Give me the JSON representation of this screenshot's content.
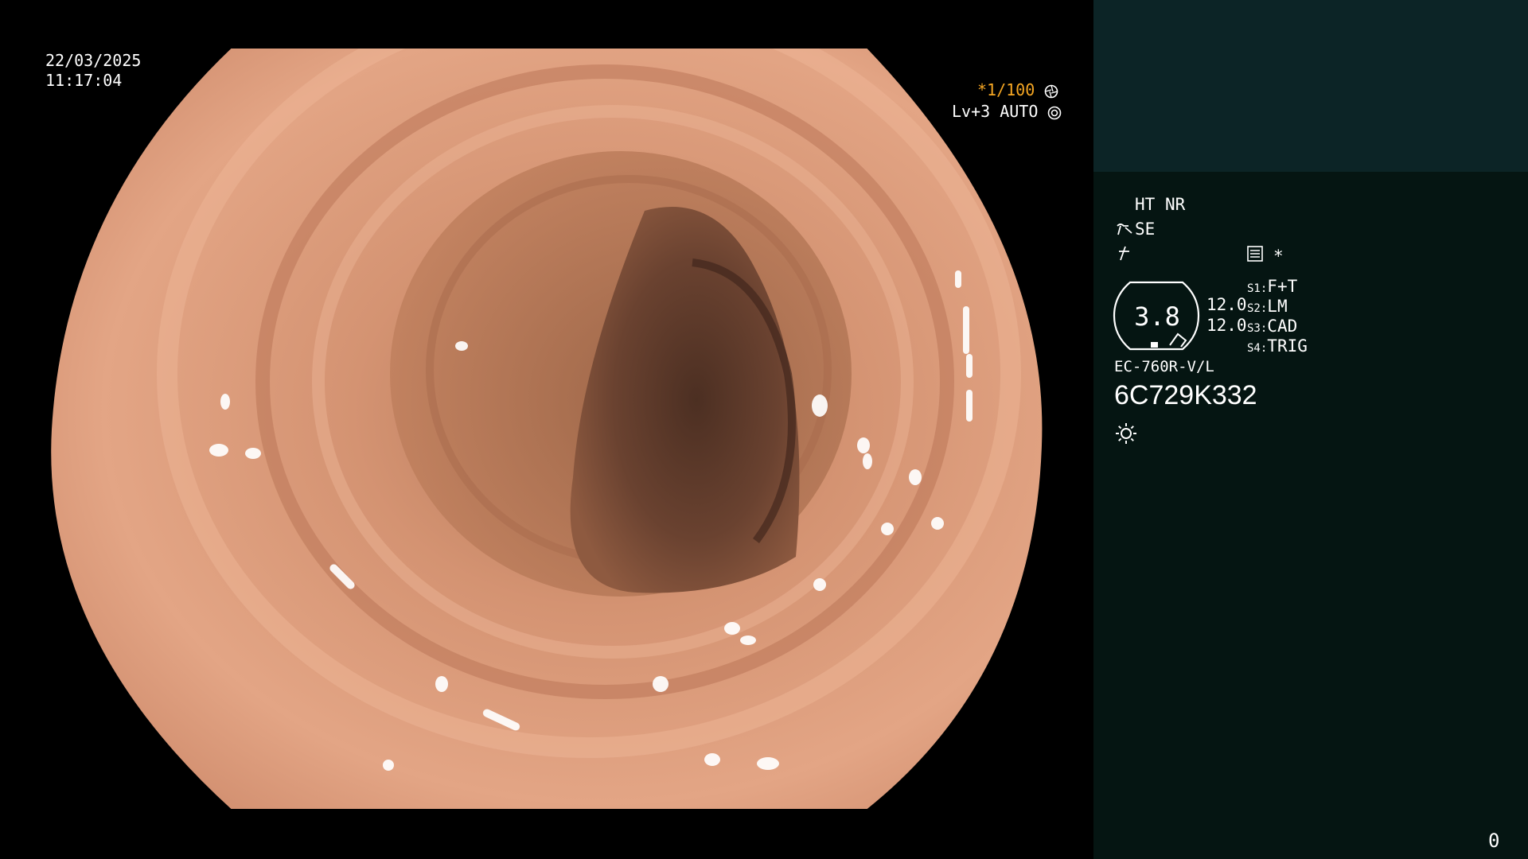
{
  "viewport": {
    "date": "22/03/2025",
    "time": "11:17:04",
    "shutter": "*1/100",
    "shutter_icon": "aperture-icon",
    "level": "Lv+3 AUTO",
    "level_icon": "iris-auto-icon"
  },
  "panel": {
    "ht_label": "HT",
    "nr_label": "NR",
    "se_label": "SE",
    "se_icon": "wave-enhance-icon",
    "filter_icon": "freeze-slash-icon",
    "memo_icon": "memo-list-icon",
    "asterisk": "*",
    "scope_value": "3.8",
    "scope_range_1": "12.0",
    "scope_range_2": "12.0",
    "settings": [
      {
        "key": "S1:",
        "value": "F+T"
      },
      {
        "key": "S2:",
        "value": "LM"
      },
      {
        "key": "S3:",
        "value": "CAD"
      },
      {
        "key": "S4:",
        "value": "TRIG"
      }
    ],
    "scope_model": "EC-760R-V/L",
    "serial": "6C729K332",
    "light_icon": "light-sun-icon",
    "counter": "0"
  },
  "colors": {
    "accent_orange": "#f5a623",
    "panel_bg": "#051512",
    "panel_top_bg": "#0c2426",
    "tissue": "#e0a080"
  }
}
